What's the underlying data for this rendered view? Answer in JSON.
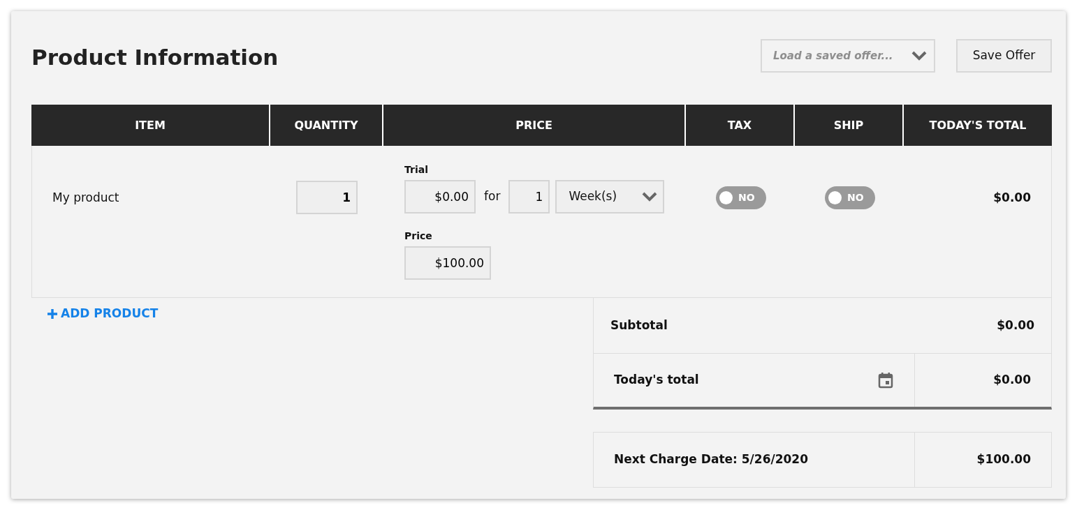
{
  "title": "Product Information",
  "offer_select": {
    "placeholder": "Load a saved offer..."
  },
  "save_button": "Save Offer",
  "table": {
    "columns": [
      "ITEM",
      "QUANTITY",
      "PRICE",
      "TAX",
      "SHIP",
      "TODAY'S TOTAL"
    ],
    "rows": [
      {
        "item": "My product",
        "quantity": "1",
        "trial_label": "Trial",
        "trial_price": "$0.00",
        "for_text": "for",
        "trial_length": "1",
        "trial_unit": "Week(s)",
        "price_label": "Price",
        "price": "$100.00",
        "tax": {
          "on": false,
          "label": "NO"
        },
        "ship": {
          "on": false,
          "label": "NO"
        },
        "total": "$0.00"
      }
    ]
  },
  "add_product": "ADD PRODUCT",
  "summary": {
    "subtotal_label": "Subtotal",
    "subtotal": "$0.00",
    "today_label": "Today's total",
    "today": "$0.00",
    "next_charge_label": "Next Charge Date: 5/26/2020",
    "next_charge": "$100.00"
  }
}
